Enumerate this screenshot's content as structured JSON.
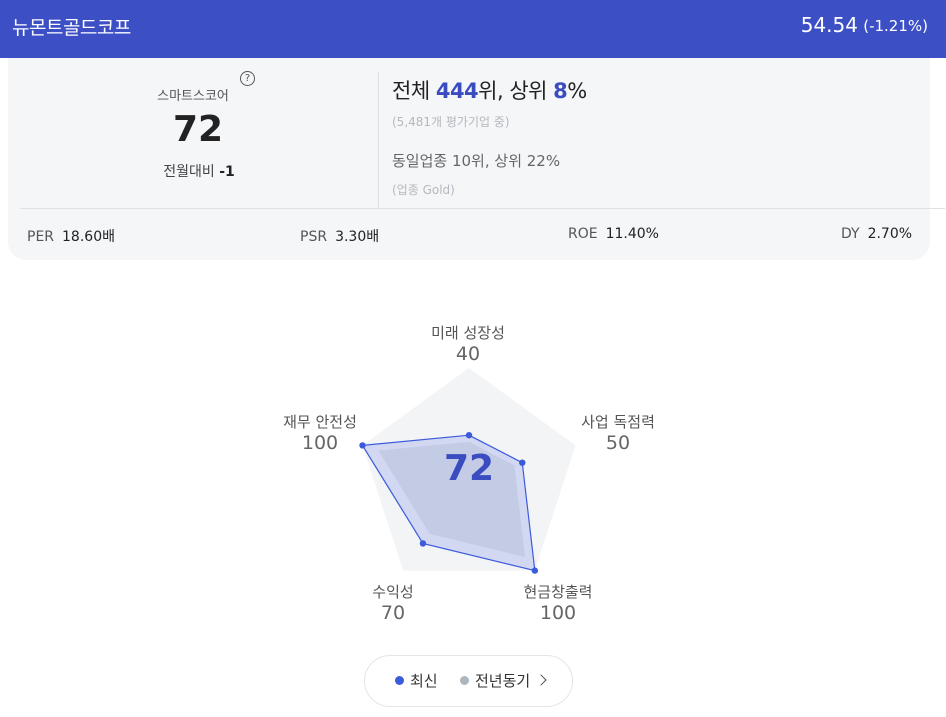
{
  "header": {
    "company": "뉴몬트골드코프",
    "price": "54.54",
    "change": "(-1.21%)"
  },
  "score_card": {
    "label": "스마트스코어",
    "help_glyph": "?",
    "score": "72",
    "mom_label": "전월대비",
    "mom_value": "-1",
    "rank_prefix": "전체 ",
    "rank_value": "444",
    "rank_mid": "위, 상위 ",
    "rank_pct": "8",
    "rank_suffix": "%",
    "rank_sub": "(5,481개 평가기업 중)",
    "industry_line": "동일업종 10위, 상위 22%",
    "industry_sub": "(업종 Gold)"
  },
  "metrics": [
    {
      "label": "PER",
      "value": "18.60배"
    },
    {
      "label": "PSR",
      "value": "3.30배"
    },
    {
      "label": "ROE",
      "value": "11.40%"
    },
    {
      "label": "DY",
      "value": "2.70%"
    }
  ],
  "chart_data": {
    "type": "radar",
    "center_value": "72",
    "axes": [
      "미래 성장성",
      "사업 독점력",
      "현금창출력",
      "수익성",
      "재무 안전성"
    ],
    "range": [
      0,
      100
    ],
    "series": [
      {
        "name": "최신",
        "values": [
          40,
          50,
          100,
          70,
          100
        ],
        "color": "#3b5bdb"
      },
      {
        "name": "전년동기",
        "values": [
          40,
          50,
          100,
          70,
          100
        ],
        "color": "#adb5bd"
      }
    ],
    "axis_values": [
      "40",
      "50",
      "100",
      "70",
      "100"
    ]
  },
  "legend": {
    "latest": "최신",
    "prior": "전년동기",
    "latest_color": "#3b5bdb",
    "prior_color": "#adb5bd"
  },
  "colors": {
    "brand": "#3c4fc5",
    "accent": "#3b4cc0"
  }
}
